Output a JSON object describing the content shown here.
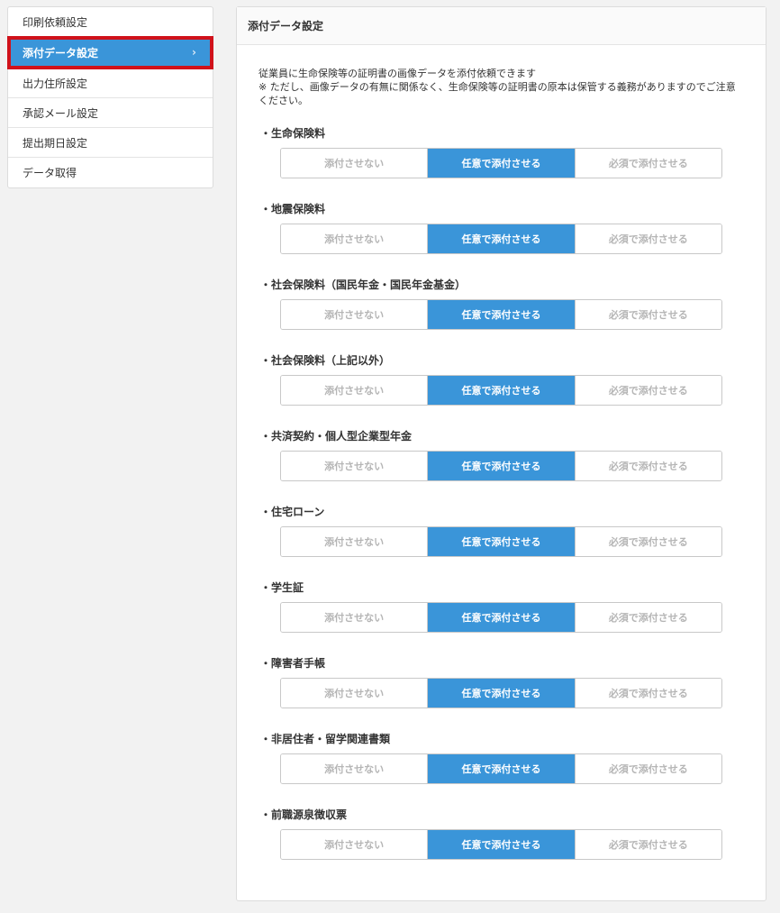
{
  "sidebar": {
    "items": [
      {
        "label": "印刷依頼設定",
        "active": false
      },
      {
        "label": "添付データ設定",
        "active": true
      },
      {
        "label": "出力住所設定",
        "active": false
      },
      {
        "label": "承認メール設定",
        "active": false
      },
      {
        "label": "提出期日設定",
        "active": false
      },
      {
        "label": "データ取得",
        "active": false
      }
    ],
    "active_chevron": "›"
  },
  "panel": {
    "title": "添付データ設定",
    "description_line1": "従業員に生命保険等の証明書の画像データを添付依頼できます",
    "description_line2": "※ ただし、画像データの有無に関係なく、生命保険等の証明書の原本は保管する義務がありますのでご注意ください。"
  },
  "options": [
    "添付させない",
    "任意で添付させる",
    "必須で添付させる"
  ],
  "sections": [
    {
      "label": "・生命保険料",
      "selected": 1
    },
    {
      "label": "・地震保険料",
      "selected": 1
    },
    {
      "label": "・社会保険料（国民年金・国民年金基金）",
      "selected": 1
    },
    {
      "label": "・社会保険料（上記以外）",
      "selected": 1
    },
    {
      "label": "・共済契約・個人型企業型年金",
      "selected": 1
    },
    {
      "label": "・住宅ローン",
      "selected": 1
    },
    {
      "label": "・学生証",
      "selected": 1
    },
    {
      "label": "・障害者手帳",
      "selected": 1
    },
    {
      "label": "・非居住者・留学関連書類",
      "selected": 1
    },
    {
      "label": "・前職源泉徴収票",
      "selected": 1
    }
  ],
  "colors": {
    "accent": "#3a95d9",
    "highlight": "#d0121b"
  }
}
